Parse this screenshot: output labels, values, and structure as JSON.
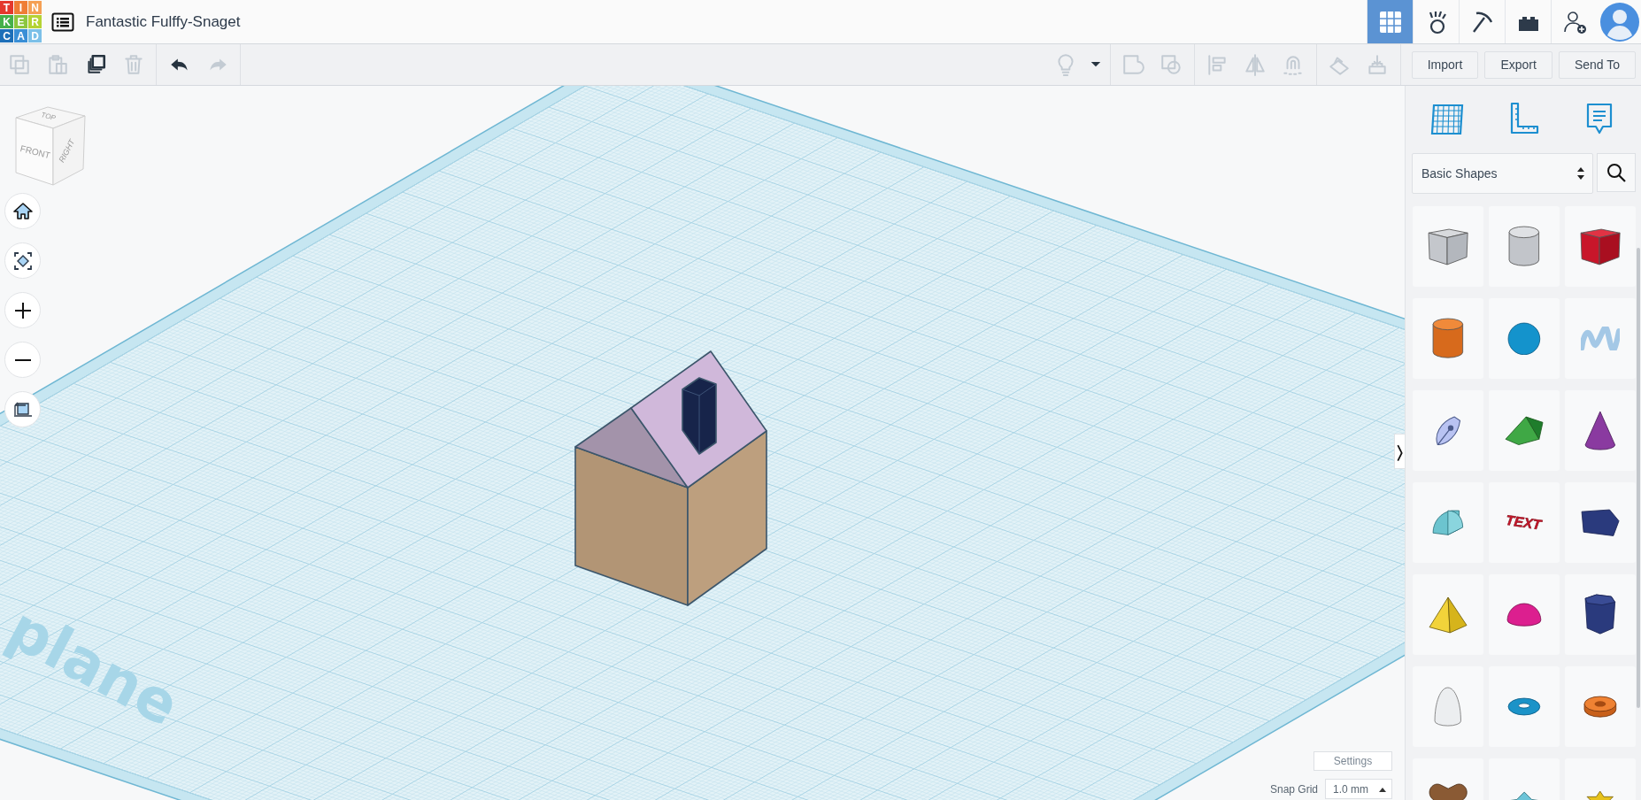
{
  "header": {
    "logo": [
      {
        "letter": "T",
        "color": "#e4382d"
      },
      {
        "letter": "I",
        "color": "#ef7d35"
      },
      {
        "letter": "N",
        "color": "#f5a054"
      },
      {
        "letter": "K",
        "color": "#45b04a"
      },
      {
        "letter": "E",
        "color": "#8cc63f"
      },
      {
        "letter": "R",
        "color": "#b5d334"
      },
      {
        "letter": "C",
        "color": "#1d6fb8"
      },
      {
        "letter": "A",
        "color": "#3a8fd6"
      },
      {
        "letter": "D",
        "color": "#7cc0e8"
      }
    ],
    "title": "Fantastic Fulffy-Snaget",
    "apps": [
      {
        "kind": "grid",
        "selected": true
      },
      {
        "kind": "circuits",
        "selected": false
      },
      {
        "kind": "pickaxe",
        "selected": false
      },
      {
        "kind": "bricks",
        "selected": false
      },
      {
        "kind": "add-user",
        "selected": false
      }
    ]
  },
  "toolbar": {
    "left": [
      {
        "kind": "copy",
        "disabled": true
      },
      {
        "kind": "paste",
        "disabled": true
      },
      {
        "kind": "duplicate",
        "disabled": false
      },
      {
        "kind": "delete",
        "disabled": true
      },
      {
        "kind": "undo",
        "disabled": false
      },
      {
        "kind": "redo",
        "disabled": true
      }
    ],
    "right": [
      {
        "kind": "bulb",
        "disabled": true
      },
      {
        "kind": "dropdown",
        "disabled": false
      },
      {
        "kind": "group",
        "disabled": true
      },
      {
        "kind": "ungroup",
        "disabled": true
      },
      {
        "kind": "align",
        "disabled": true
      },
      {
        "kind": "mirror",
        "disabled": true
      },
      {
        "kind": "magnet",
        "disabled": true
      },
      {
        "kind": "workplane",
        "disabled": true
      },
      {
        "kind": "drop",
        "disabled": true
      }
    ],
    "buttons": [
      "Import",
      "Export",
      "Send To"
    ]
  },
  "view_cube": {
    "top": "TOP",
    "front": "FRONT",
    "right": "RIGHT"
  },
  "nav_buttons": [
    {
      "kind": "home"
    },
    {
      "kind": "fit"
    },
    {
      "kind": "zoom-in"
    },
    {
      "kind": "zoom-out"
    },
    {
      "kind": "ortho"
    }
  ],
  "workplane": {
    "label": "plane"
  },
  "footer": {
    "settings": "Settings",
    "snap_label": "Snap Grid",
    "snap_value": "1.0 mm"
  },
  "panel": {
    "tools": [
      {
        "kind": "workplane"
      },
      {
        "kind": "ruler"
      },
      {
        "kind": "notes"
      }
    ],
    "category": "Basic Shapes",
    "shapes": [
      {
        "kind": "box-hole"
      },
      {
        "kind": "cylinder-hole"
      },
      {
        "kind": "box"
      },
      {
        "kind": "cylinder"
      },
      {
        "kind": "sphere"
      },
      {
        "kind": "scribble"
      },
      {
        "kind": "shape-generator"
      },
      {
        "kind": "roof"
      },
      {
        "kind": "cone"
      },
      {
        "kind": "round-roof"
      },
      {
        "kind": "text",
        "label": "TEXT"
      },
      {
        "kind": "polygon"
      },
      {
        "kind": "pyramid"
      },
      {
        "kind": "half-sphere"
      },
      {
        "kind": "prism"
      },
      {
        "kind": "paraboloid"
      },
      {
        "kind": "torus"
      },
      {
        "kind": "tube"
      },
      {
        "kind": "heart"
      },
      {
        "kind": "icosahedron"
      },
      {
        "kind": "star"
      }
    ]
  }
}
